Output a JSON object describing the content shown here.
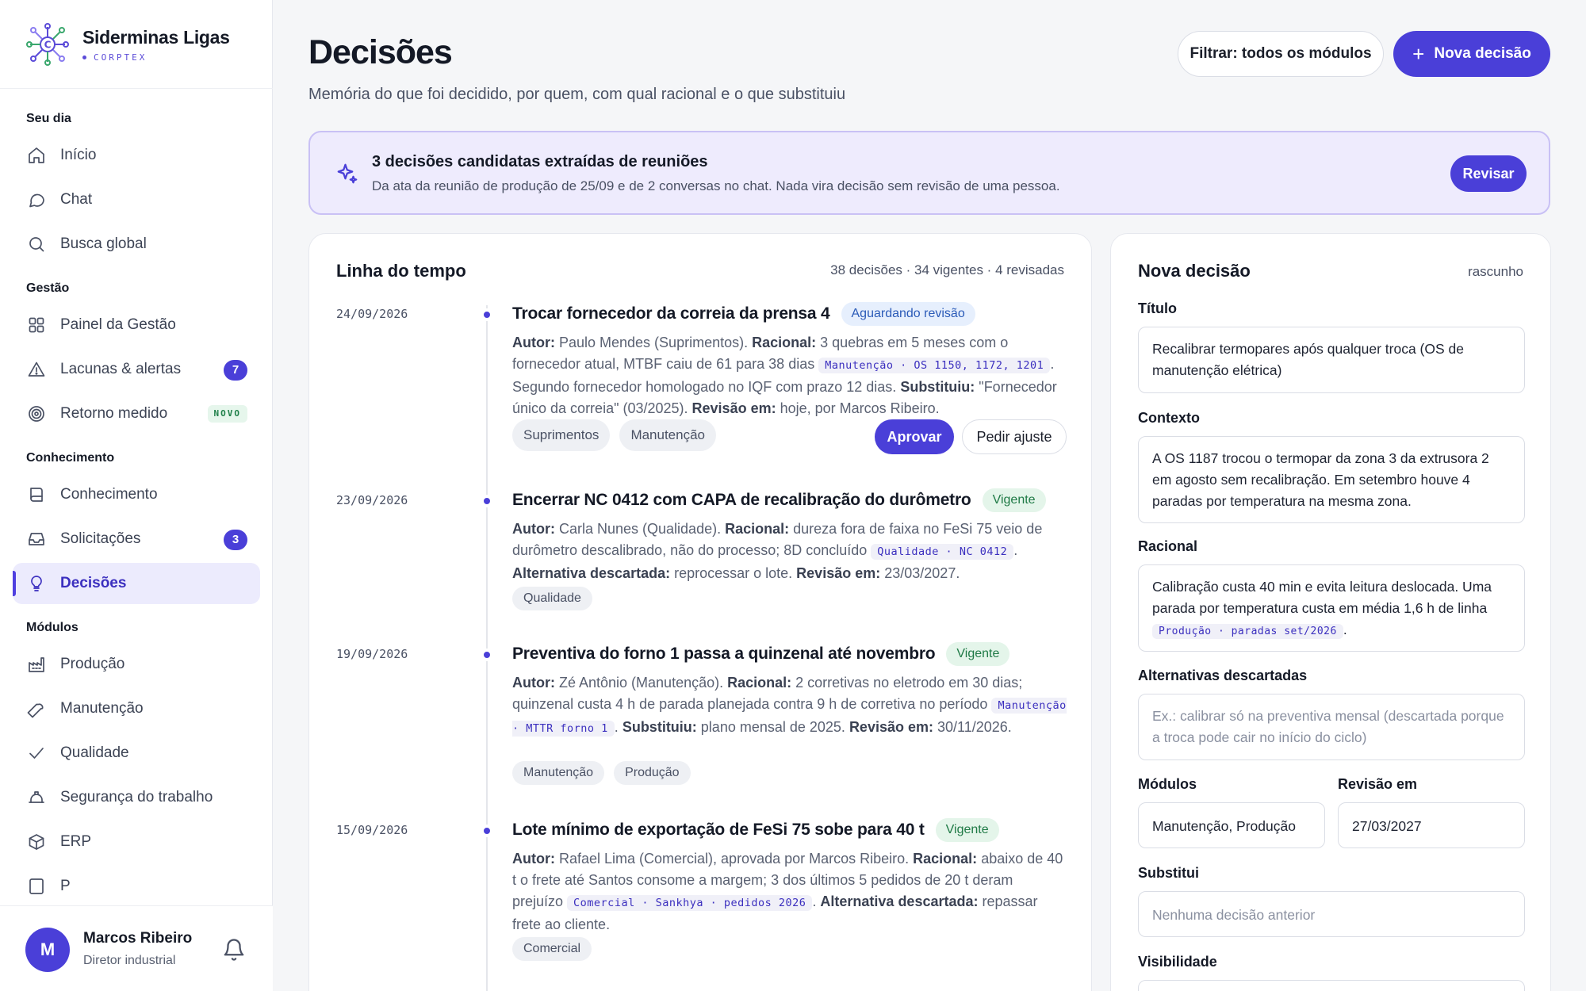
{
  "brand": {
    "name": "Siderminas Ligas",
    "sub": "CORPTEX"
  },
  "sidebar": {
    "sections": [
      {
        "title": "Seu dia",
        "items": [
          {
            "label": "Início",
            "icon": "home-icon"
          },
          {
            "label": "Chat",
            "icon": "chat-icon"
          },
          {
            "label": "Busca global",
            "icon": "search-icon"
          }
        ]
      },
      {
        "title": "Gestão",
        "items": [
          {
            "label": "Painel da Gestão",
            "icon": "dashboard-icon"
          },
          {
            "label": "Lacunas & alertas",
            "icon": "alert-icon",
            "badge": "7"
          },
          {
            "label": "Retorno medido",
            "icon": "target-icon",
            "tag": "NOVO"
          }
        ]
      },
      {
        "title": "Conhecimento",
        "items": [
          {
            "label": "Conhecimento",
            "icon": "book-icon"
          },
          {
            "label": "Solicitações",
            "icon": "inbox-icon",
            "badge": "3"
          },
          {
            "label": "Decisões",
            "icon": "lightbulb-icon",
            "active": true
          }
        ]
      },
      {
        "title": "Módulos",
        "items": [
          {
            "label": "Produção",
            "icon": "factory-icon"
          },
          {
            "label": "Manutenção",
            "icon": "wrench-icon"
          },
          {
            "label": "Qualidade",
            "icon": "check-icon"
          },
          {
            "label": "Segurança do trabalho",
            "icon": "helmet-icon"
          },
          {
            "label": "ERP",
            "icon": "cube-icon"
          },
          {
            "label": "P",
            "icon": "page-icon"
          }
        ]
      }
    ]
  },
  "user": {
    "initial": "M",
    "name": "Marcos Ribeiro",
    "role": "Diretor industrial"
  },
  "header": {
    "title": "Decisões",
    "subtitle": "Memória do que foi decidido, por quem, com qual racional e o que substituiu",
    "filter_label": "Filtrar: todos os módulos",
    "new_label": "Nova decisão"
  },
  "banner": {
    "title": "3 decisões candidatas extraídas de reuniões",
    "desc": "Da ata da reunião de produção de 25/09 e de 2 conversas no chat. Nada vira decisão sem revisão de uma pessoa.",
    "button": "Revisar"
  },
  "timeline": {
    "title": "Linha do tempo",
    "stats": "38 decisões · 34 vigentes · 4 revisadas",
    "entries": [
      {
        "date": "24/09/2026",
        "title": "Trocar fornecedor da correia da prensa 4",
        "status": "Aguardando revisão",
        "author_label": "Autor:",
        "author": " Paulo Mendes (Suprimentos). ",
        "r_label": "Racional:",
        "r_text": " 3 quebras em 5 meses com o fornecedor atual, MTBF caiu de 61 para 38 dias ",
        "code": "Manutenção · OS 1150, 1172, 1201",
        "after_code": ". Segundo fornecedor homologado no IQF com prazo 12 dias. ",
        "x_label": "Substituiu:",
        "x_text": " \"Fornecedor único da correia\" (03/2025). ",
        "rev_label": "Revisão em:",
        "rev_text": " hoje, por Marcos Ribeiro.",
        "tags": [
          "Suprimentos",
          "Manutenção"
        ],
        "approve": "Aprovar",
        "adjust": "Pedir ajuste"
      },
      {
        "date": "23/09/2026",
        "title": "Encerrar NC 0412 com CAPA de recalibração do durômetro",
        "status": "Vigente",
        "author_label": "Autor:",
        "author": " Carla Nunes (Qualidade). ",
        "r_label": "Racional:",
        "r_text": " dureza fora de faixa no FeSi 75 veio de durômetro descalibrado, não do processo; 8D concluído ",
        "code": "Qualidade · NC 0412",
        "after_code": ". ",
        "x_label": "Alternativa descartada:",
        "x_text": " reprocessar o lote. ",
        "rev_label": "Revisão em:",
        "rev_text": " 23/03/2027.",
        "tags": [
          "Qualidade"
        ]
      },
      {
        "date": "19/09/2026",
        "title": "Preventiva do forno 1 passa a quinzenal até novembro",
        "status": "Vigente",
        "author_label": "Autor:",
        "author": " Zé Antônio (Manutenção). ",
        "r_label": "Racional:",
        "r_text": " 2 corretivas no eletrodo em 30 dias; quinzenal custa 4 h de parada planejada contra 9 h de corretiva no período ",
        "code": "Manutenção · MTTR forno 1",
        "after_code": ". ",
        "x_label": "Substituiu:",
        "x_text": " plano mensal de 2025. ",
        "rev_label": "Revisão em:",
        "rev_text": " 30/11/2026.",
        "tags": [
          "Manutenção",
          "Produção"
        ]
      },
      {
        "date": "15/09/2026",
        "title": "Lote mínimo de exportação de FeSi 75 sobe para 40 t",
        "status": "Vigente",
        "author_label": "Autor:",
        "author": " Rafael Lima (Comercial), aprovada por Marcos Ribeiro. ",
        "r_label": "Racional:",
        "r_text": " abaixo de 40 t o frete até Santos consome a margem; 3 dos últimos 5 pedidos de 20 t deram prejuízo ",
        "code": "Comercial · Sankhya · pedidos 2026",
        "after_code": ". ",
        "x_label": "Alternativa descartada:",
        "x_text": " repassar frete ao cliente.",
        "rev_label": "",
        "rev_text": "",
        "tags": [
          "Comercial"
        ]
      }
    ]
  },
  "form": {
    "title": "Nova decisão",
    "draft": "rascunho",
    "titulo_label": "Título",
    "titulo_value": "Recalibrar termopares após qualquer troca (OS de manutenção elétrica)",
    "contexto_label": "Contexto",
    "contexto_value": "A OS 1187 trocou o termopar da zona 3 da extrusora 2 em agosto sem recalibração. Em setembro houve 4 paradas por temperatura na mesma zona.",
    "racional_label": "Racional",
    "racional_value": "Calibração custa 40 min e evita leitura deslocada. Uma parada por temperatura custa em média 1,6 h de linha ",
    "racional_code": "Produção · paradas set/2026",
    "racional_end": ".",
    "alt_label": "Alternativas descartadas",
    "alt_placeholder": "Ex.: calibrar só na preventiva mensal (descartada porque a troca pode cair no início do ciclo)",
    "modulos_label": "Módulos",
    "modulos_value": "Manutenção, Produção",
    "revisao_label": "Revisão em",
    "revisao_value": "27/03/2027",
    "substitui_label": "Substitui",
    "substitui_placeholder": "Nenhuma decisão anterior",
    "visibilidade_label": "Visibilidade"
  },
  "colors": {
    "accent": "#4a3fd8",
    "banner_bg": "#eeebfd",
    "valid": "#1f7a46",
    "review": "#2b5bb8"
  }
}
